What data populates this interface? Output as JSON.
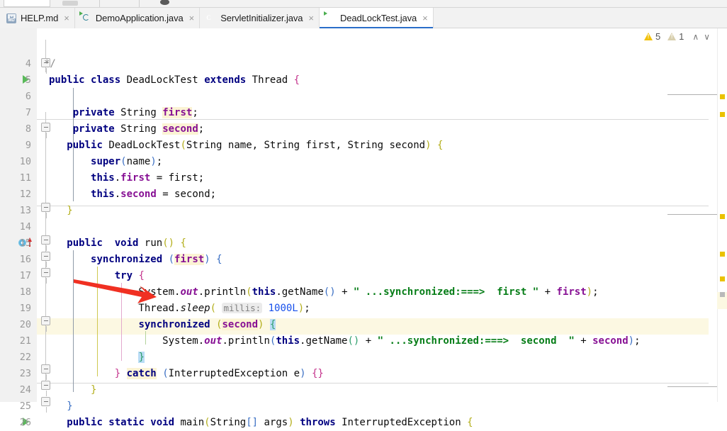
{
  "window": {
    "app": "IntelliJ IDEA editor"
  },
  "tabs": [
    {
      "label": "HELP.md",
      "icon": "markdown-icon",
      "icon_text": "MD",
      "active": false,
      "close": "×"
    },
    {
      "label": "DemoApplication.java",
      "icon": "spring-class-icon",
      "icon_text": "",
      "active": false,
      "close": "×"
    },
    {
      "label": "ServletInitializer.java",
      "icon": "java-class-icon",
      "icon_text": "C",
      "active": false,
      "close": "×"
    },
    {
      "label": "DeadLockTest.java",
      "icon": "java-runnable-class-icon",
      "icon_text": "C",
      "active": true,
      "close": "×"
    }
  ],
  "inspections": {
    "warning_icon": "warning-triangle-icon",
    "warning_count": "5",
    "weak_warning_icon": "weak-warning-triangle-icon",
    "weak_warning_count": "1",
    "prev_label": "∧",
    "next_label": "∨"
  },
  "editor": {
    "file": "DeadLockTest.java",
    "current_line": "22",
    "first_visible_line": "4",
    "last_visible_line": "26",
    "inlay_hint_line19": "millis:",
    "lines": [
      {
        "n": "4",
        "text": "*/"
      },
      {
        "n": "5",
        "text": "public class DeadLockTest extends Thread {"
      },
      {
        "n": "6",
        "text": ""
      },
      {
        "n": "7",
        "text": "    private String first;"
      },
      {
        "n": "8",
        "text": "    private String second;"
      },
      {
        "n": "9",
        "text": "    public DeadLockTest(String name, String first, String second) {"
      },
      {
        "n": "10",
        "text": "        super(name);"
      },
      {
        "n": "11",
        "text": "        this.first = first;"
      },
      {
        "n": "12",
        "text": "        this.second = second;"
      },
      {
        "n": "13",
        "text": "    }"
      },
      {
        "n": "14",
        "text": ""
      },
      {
        "n": "15",
        "text": "    public  void run() {"
      },
      {
        "n": "16",
        "text": "        synchronized (first) {"
      },
      {
        "n": "17",
        "text": "            try {"
      },
      {
        "n": "18",
        "text": "                System.out.println(this.getName() + \" ...synchronized:===>  first \" + first);"
      },
      {
        "n": "19",
        "text": "                Thread.sleep( millis: 1000L);"
      },
      {
        "n": "20",
        "text": "                synchronized (second) {"
      },
      {
        "n": "21",
        "text": "                    System.out.println(this.getName() + \" ...synchronized:===>  second  \" + second);"
      },
      {
        "n": "22",
        "text": "                }"
      },
      {
        "n": "23",
        "text": "            } catch (InterruptedException e) {}"
      },
      {
        "n": "24",
        "text": "        }"
      },
      {
        "n": "25",
        "text": "    }"
      },
      {
        "n": "26",
        "text": "    public static void main(String[] args) throws InterruptedException {"
      }
    ],
    "gutter_markers": [
      {
        "line": "5",
        "type": "run-class-arrow"
      },
      {
        "line": "15",
        "type": "implementing-method-marker"
      },
      {
        "line": "26",
        "type": "run-method-arrow"
      }
    ]
  },
  "annotation": {
    "type": "red-arrow",
    "points_at_line": "20"
  },
  "colors": {
    "keyword": "#000080",
    "field": "#871094",
    "string": "#067d17",
    "number": "#1750eb",
    "identifier_highlight": "#fbf3d4",
    "current_line": "#fcf8e2",
    "matching_brace": "#b9dcf5",
    "warning": "#eac200",
    "active_tab_underline": "#2a6ec9",
    "annotation_arrow": "#f03022"
  }
}
